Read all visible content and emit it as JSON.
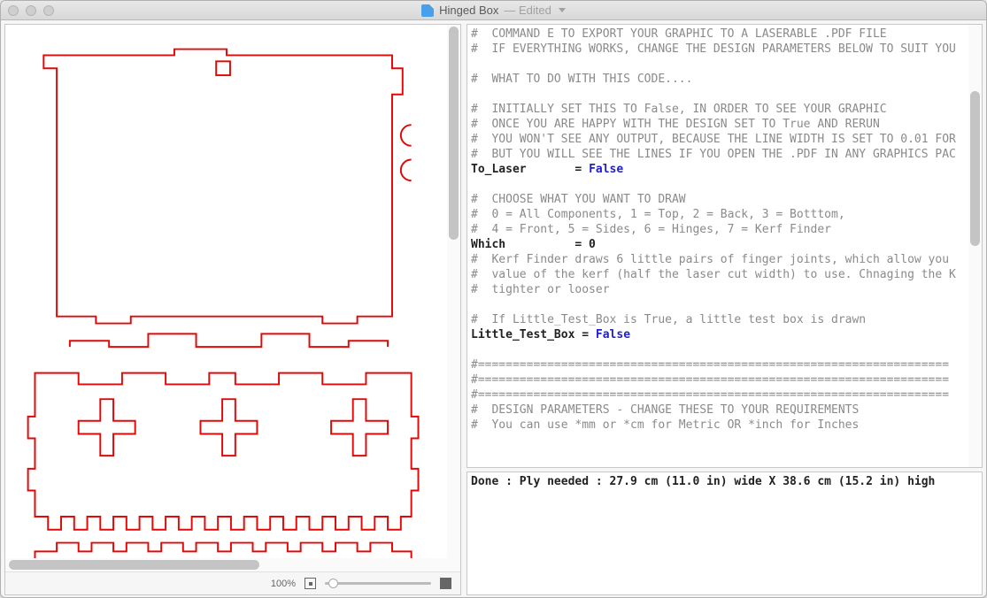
{
  "window": {
    "title": "Hinged Box",
    "edited_suffix": "— Edited"
  },
  "zoom": {
    "level": "100%"
  },
  "code": {
    "c1": "#  COMMAND E TO EXPORT YOUR GRAPHIC TO A LASERABLE .PDF FILE",
    "c2": "#  IF EVERYTHING WORKS, CHANGE THE DESIGN PARAMETERS BELOW TO SUIT YOU",
    "c3": "#  WHAT TO DO WITH THIS CODE....",
    "c4": "#  INITIALLY SET THIS TO False, IN ORDER TO SEE YOUR GRAPHIC",
    "c5": "#  ONCE YOU ARE HAPPY WITH THE DESIGN SET TO True AND RERUN",
    "c6": "#  YOU WON'T SEE ANY OUTPUT, BECAUSE THE LINE WIDTH IS SET TO 0.01 FOR",
    "c7": "#  BUT YOU WILL SEE THE LINES IF YOU OPEN THE .PDF IN ANY GRAPHICS PAC",
    "v1": "To_Laser       = ",
    "v1k": "False",
    "c8": "#  CHOOSE WHAT YOU WANT TO DRAW",
    "c9": "#  0 = All Components, 1 = Top, 2 = Back, 3 = Botttom,",
    "c10": "#  4 = Front, 5 = Sides, 6 = Hinges, 7 = Kerf Finder",
    "v2": "Which          = 0",
    "c11": "#  Kerf Finder draws 6 little pairs of finger joints, which allow you ",
    "c12": "#  value of the kerf (half the laser cut width) to use. Chnaging the K",
    "c13": "#  tighter or looser",
    "c14": "#  If Little_Test_Box is True, a little test box is drawn",
    "v3": "Little_Test_Box = ",
    "v3k": "False",
    "hr": "#====================================================================",
    "c15": "#  DESIGN PARAMETERS - CHANGE THESE TO YOUR REQUIREMENTS",
    "c16": "#  You can use *mm or *cm for Metric OR *inch for Inches"
  },
  "console": {
    "output": "Done : Ply needed : 27.9 cm (11.0 in) wide X 38.6 cm (15.2 in) high"
  }
}
